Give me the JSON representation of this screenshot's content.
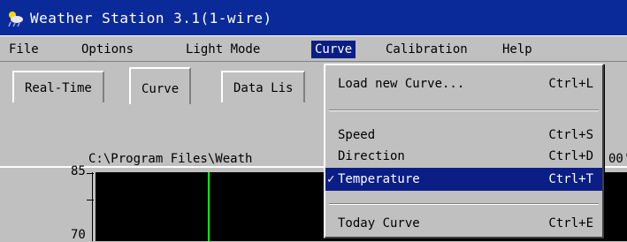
{
  "window": {
    "title": "Weather Station 3.1(1-wire)",
    "icon": "weather-station-app-icon"
  },
  "menubar": {
    "items": [
      {
        "label": "File"
      },
      {
        "label": "Options"
      },
      {
        "label": "Light Mode"
      },
      {
        "label": "Curve"
      },
      {
        "label": "Calibration"
      },
      {
        "label": "Help"
      }
    ],
    "active": "Curve"
  },
  "tabs": [
    {
      "label": "Real-Time"
    },
    {
      "label": "Curve"
    },
    {
      "label": "Data Lis"
    }
  ],
  "selected_tab": "Curve",
  "chart": {
    "file_path": "C:\\Program Files\\Weath",
    "path_suffix": "00'",
    "y_ticks": [
      "85",
      "70"
    ]
  },
  "dropdown": {
    "items": [
      {
        "label": "Load new Curve...",
        "shortcut": "Ctrl+L"
      },
      {
        "label": "Speed",
        "shortcut": "Ctrl+S"
      },
      {
        "label": "Direction",
        "shortcut": "Ctrl+D"
      },
      {
        "label": "Temperature",
        "shortcut": "Ctrl+T",
        "checked": true,
        "highlighted": true
      },
      {
        "label": "Today Curve",
        "shortcut": "Ctrl+E"
      }
    ],
    "check_glyph": "✓"
  },
  "colors": {
    "title_bg": "#0a2a9a",
    "highlight": "#0a1e86",
    "plot_bg": "#000000",
    "trace": "#00ff00"
  }
}
